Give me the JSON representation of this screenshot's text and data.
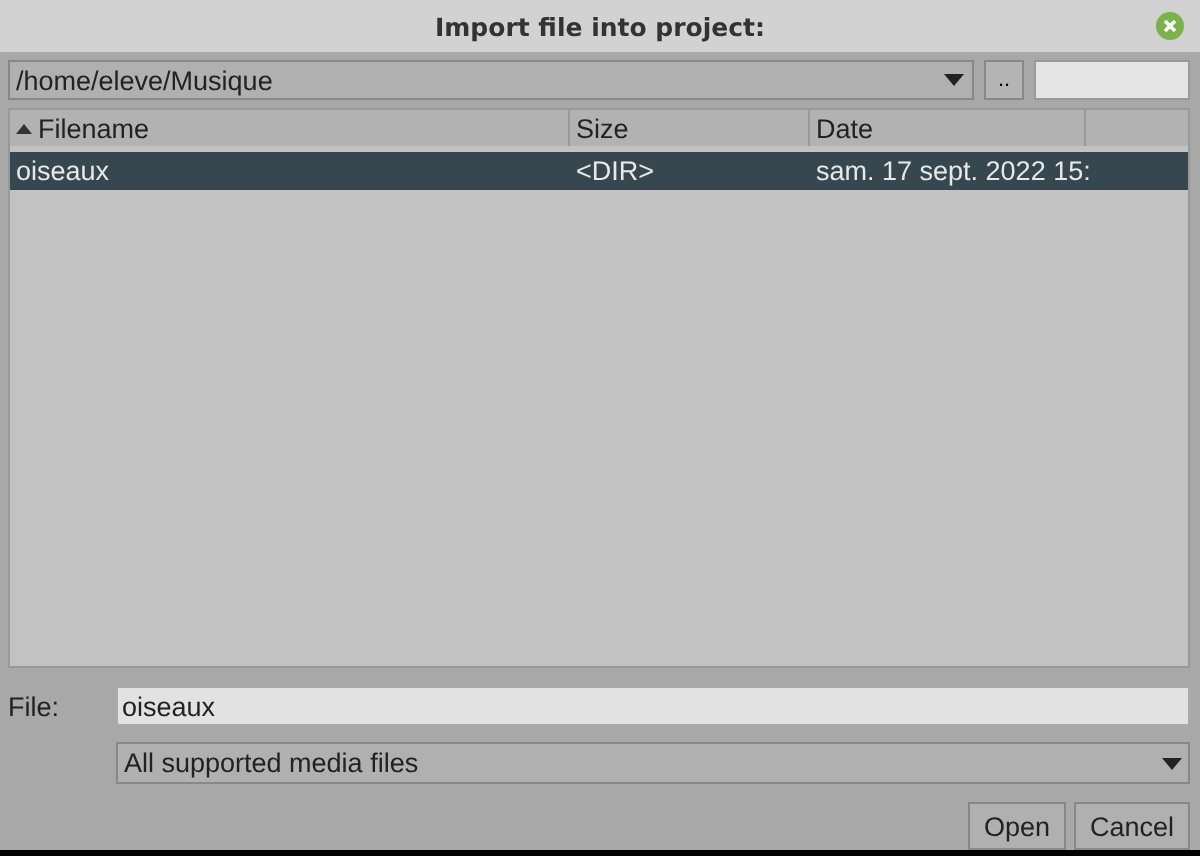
{
  "window": {
    "title": "Import file into project:"
  },
  "path_bar": {
    "path": "/home/eleve/Musique",
    "up_button": ".."
  },
  "table": {
    "columns": [
      {
        "label": "Filename",
        "sorted": true
      },
      {
        "label": "Size",
        "sorted": false
      },
      {
        "label": "Date",
        "sorted": false
      }
    ],
    "rows": [
      {
        "cells": [
          "oiseaux",
          "<DIR>",
          "sam. 17 sept. 2022 15:"
        ],
        "selected": true
      }
    ]
  },
  "file": {
    "label": "File:",
    "value": "oiseaux"
  },
  "filter": {
    "value": "All supported media files"
  },
  "buttons": [
    "Open",
    "Cancel"
  ]
}
